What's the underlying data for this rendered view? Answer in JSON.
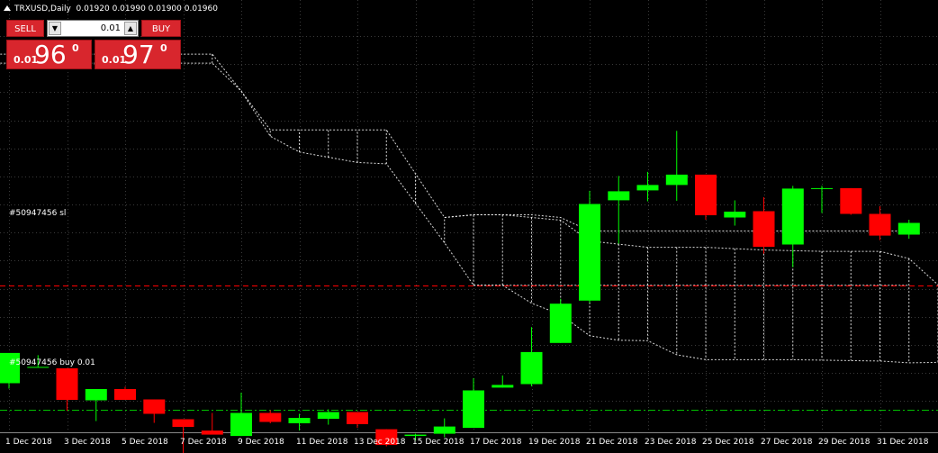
{
  "header": {
    "symbol_timeframe": "TRXUSD,Daily",
    "ohlc": "0.01920 0.01990 0.01900 0.01960"
  },
  "trade_panel": {
    "sell_label": "SELL",
    "buy_label": "BUY",
    "lot_value": "0.01",
    "sell_price": {
      "small": "0.01",
      "big": "96",
      "sup": "0"
    },
    "buy_price": {
      "small": "0.01",
      "big": "97",
      "sup": "0"
    }
  },
  "trade_lines": {
    "sl_label": "#50947456 sl",
    "buy_label": "#50947456 buy 0.01"
  },
  "colors": {
    "bull": "#00ff00",
    "bear": "#ff0000",
    "background": "#000000",
    "grid": "#3a3a3a",
    "cloud": "#ffffff",
    "sl_line": "#ff0000",
    "buy_line": "#00c000"
  },
  "chart_data": {
    "type": "candlestick",
    "title": "TRXUSD,Daily",
    "grid": true,
    "ylim": [
      0.0135,
      0.022
    ],
    "x_tick_labels": [
      "1 Dec 2018",
      "3 Dec 2018",
      "5 Dec 2018",
      "7 Dec 2018",
      "9 Dec 2018",
      "11 Dec 2018",
      "13 Dec 2018",
      "15 Dec 2018",
      "17 Dec 2018",
      "19 Dec 2018",
      "21 Dec 2018",
      "23 Dec 2018",
      "25 Dec 2018",
      "27 Dec 2018",
      "29 Dec 2018",
      "31 Dec 2018"
    ],
    "candles": [
      {
        "date": "1 Dec 2018",
        "open": 0.01403,
        "high": 0.01454,
        "low": 0.01391,
        "close": 0.0147
      },
      {
        "date": "2 Dec 2018",
        "open": 0.01439,
        "high": 0.01465,
        "low": 0.01439,
        "close": 0.01439
      },
      {
        "date": "3 Dec 2018",
        "open": 0.01436,
        "high": 0.01436,
        "low": 0.01342,
        "close": 0.01366
      },
      {
        "date": "4 Dec 2018",
        "open": 0.01365,
        "high": 0.01373,
        "low": 0.01319,
        "close": 0.0139
      },
      {
        "date": "5 Dec 2018",
        "open": 0.0139,
        "high": 0.01395,
        "low": 0.01366,
        "close": 0.01366
      },
      {
        "date": "6 Dec 2018",
        "open": 0.01367,
        "high": 0.01367,
        "low": 0.01315,
        "close": 0.01335
      },
      {
        "date": "7 Dec 2018",
        "open": 0.01323,
        "high": 0.01323,
        "low": 0.01241,
        "close": 0.01306
      },
      {
        "date": "8 Dec 2018",
        "open": 0.01298,
        "high": 0.01337,
        "low": 0.01291,
        "close": 0.01289
      },
      {
        "date": "9 Dec 2018",
        "open": 0.01286,
        "high": 0.01382,
        "low": 0.01286,
        "close": 0.01337
      },
      {
        "date": "10 Dec 2018",
        "open": 0.01337,
        "high": 0.01343,
        "low": 0.01314,
        "close": 0.01317
      },
      {
        "date": "11 Dec 2018",
        "open": 0.01314,
        "high": 0.01335,
        "low": 0.01298,
        "close": 0.01326
      },
      {
        "date": "12 Dec 2018",
        "open": 0.01324,
        "high": 0.01345,
        "low": 0.01311,
        "close": 0.01339
      },
      {
        "date": "13 Dec 2018",
        "open": 0.01339,
        "high": 0.01339,
        "low": 0.01304,
        "close": 0.01312
      },
      {
        "date": "14 Dec 2018",
        "open": 0.01301,
        "high": 0.01301,
        "low": 0.01263,
        "close": 0.01266
      },
      {
        "date": "15 Dec 2018",
        "open": 0.01286,
        "high": 0.01291,
        "low": 0.01276,
        "close": 0.01289
      },
      {
        "date": "16 Dec 2018",
        "open": 0.01291,
        "high": 0.01325,
        "low": 0.01283,
        "close": 0.01307
      },
      {
        "date": "17 Dec 2018",
        "open": 0.01304,
        "high": 0.01414,
        "low": 0.01304,
        "close": 0.01387
      },
      {
        "date": "18 Dec 2018",
        "open": 0.01393,
        "high": 0.0142,
        "low": 0.01393,
        "close": 0.01399
      },
      {
        "date": "19 Dec 2018",
        "open": 0.01401,
        "high": 0.01527,
        "low": 0.01396,
        "close": 0.01472
      },
      {
        "date": "20 Dec 2018",
        "open": 0.01492,
        "high": 0.0159,
        "low": 0.01492,
        "close": 0.01579
      },
      {
        "date": "21 Dec 2018",
        "open": 0.01586,
        "high": 0.01829,
        "low": 0.01581,
        "close": 0.018
      },
      {
        "date": "22 Dec 2018",
        "open": 0.01808,
        "high": 0.01862,
        "low": 0.01712,
        "close": 0.01828
      },
      {
        "date": "23 Dec 2018",
        "open": 0.0183,
        "high": 0.01871,
        "low": 0.01806,
        "close": 0.01842
      },
      {
        "date": "24 Dec 2018",
        "open": 0.01842,
        "high": 0.01962,
        "low": 0.01807,
        "close": 0.01865
      },
      {
        "date": "25 Dec 2018",
        "open": 0.01865,
        "high": 0.01865,
        "low": 0.01765,
        "close": 0.01775
      },
      {
        "date": "26 Dec 2018",
        "open": 0.0177,
        "high": 0.01808,
        "low": 0.01752,
        "close": 0.01783
      },
      {
        "date": "27 Dec 2018",
        "open": 0.01784,
        "high": 0.01815,
        "low": 0.0169,
        "close": 0.01705
      },
      {
        "date": "28 Dec 2018",
        "open": 0.0171,
        "high": 0.0184,
        "low": 0.0166,
        "close": 0.01834
      },
      {
        "date": "29 Dec 2018",
        "open": 0.01835,
        "high": 0.0184,
        "low": 0.0178,
        "close": 0.01835
      },
      {
        "date": "30 Dec 2018",
        "open": 0.01835,
        "high": 0.01835,
        "low": 0.01776,
        "close": 0.01778
      },
      {
        "date": "31 Dec 2018",
        "open": 0.01778,
        "high": 0.01795,
        "low": 0.0172,
        "close": 0.0173
      },
      {
        "date": "1 Jan 2019",
        "open": 0.01732,
        "high": 0.01765,
        "low": 0.01723,
        "close": 0.01758
      }
    ],
    "cloud": {
      "lines": [
        {
          "points": [
            [
              -0.3,
              0.02132
            ],
            [
              7.0,
              0.02132
            ],
            [
              8.0,
              0.0205
            ],
            [
              9.0,
              0.0195
            ],
            [
              10.0,
              0.01915
            ],
            [
              12.0,
              0.01892
            ],
            [
              13.0,
              0.01889
            ],
            [
              15.0,
              0.01714
            ],
            [
              16.0,
              0.0162
            ],
            [
              17.0,
              0.0162
            ],
            [
              18.0,
              0.0162
            ],
            [
              19.0,
              0.0162
            ],
            [
              20.0,
              0.0162
            ],
            [
              22.0,
              0.0162
            ],
            [
              23.0,
              0.0162
            ],
            [
              26.0,
              0.0162
            ],
            [
              28.0,
              0.0162
            ],
            [
              31.0,
              0.0162
            ]
          ]
        },
        {
          "points": [
            [
              -0.3,
              0.02112
            ],
            [
              7.0,
              0.02112
            ],
            [
              8.0,
              0.0205
            ],
            [
              9.0,
              0.01964
            ],
            [
              10.0,
              0.01964
            ],
            [
              11.0,
              0.01964
            ],
            [
              12.0,
              0.01964
            ],
            [
              13.0,
              0.01964
            ],
            [
              15.0,
              0.0177
            ],
            [
              16.0,
              0.01776
            ],
            [
              17.0,
              0.01776
            ],
            [
              18.0,
              0.01776
            ],
            [
              19.0,
              0.0177
            ],
            [
              20.0,
              0.0174
            ],
            [
              22.0,
              0.0174
            ],
            [
              23.0,
              0.0174
            ],
            [
              26.0,
              0.0174
            ],
            [
              28.0,
              0.0174
            ],
            [
              31.0,
              0.0174
            ]
          ]
        },
        {
          "points": [
            [
              15.0,
              0.0177
            ],
            [
              16.0,
              0.01776
            ],
            [
              17.0,
              0.01776
            ],
            [
              18.0,
              0.0177
            ],
            [
              19.0,
              0.01764
            ],
            [
              20.0,
              0.01718
            ],
            [
              22.0,
              0.01704
            ],
            [
              24.0,
              0.01704
            ],
            [
              26.0,
              0.01698
            ],
            [
              28.0,
              0.01695
            ],
            [
              30.0,
              0.01695
            ],
            [
              31.0,
              0.01679
            ],
            [
              32.0,
              0.01621
            ],
            [
              33.0,
              0.01622
            ]
          ]
        },
        {
          "points": [
            [
              16.0,
              0.0162
            ],
            [
              17.0,
              0.0162
            ],
            [
              18.0,
              0.0158
            ],
            [
              19.0,
              0.01555
            ],
            [
              20.0,
              0.01508
            ],
            [
              21.0,
              0.01498
            ],
            [
              22.0,
              0.01497
            ],
            [
              23.0,
              0.01466
            ],
            [
              24.0,
              0.01455
            ],
            [
              25.0,
              0.01455
            ],
            [
              27.0,
              0.01455
            ],
            [
              30.0,
              0.01452
            ],
            [
              31.0,
              0.01448
            ],
            [
              32.0,
              0.01449
            ],
            [
              33.0,
              0.0144
            ]
          ]
        }
      ]
    },
    "horizontal_lines": [
      {
        "name": "#50947456 sl",
        "price": 0.0162,
        "style": "dashed",
        "color": "#ff0000"
      },
      {
        "name": "#50947456 buy 0.01",
        "price": 0.01345,
        "style": "dash-dot",
        "color": "#00c000"
      }
    ]
  }
}
